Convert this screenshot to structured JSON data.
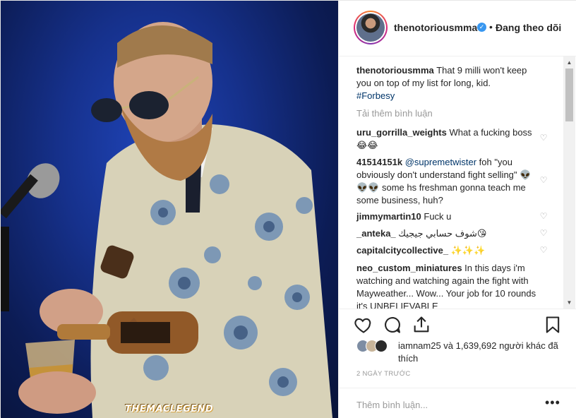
{
  "header": {
    "username": "thenotoriousmma",
    "separator": "•",
    "follow_status": "Đang theo dõi"
  },
  "caption": {
    "username": "thenotoriousmma",
    "text": "That 9 milli won't keep you on top of my list for long, kid.",
    "hashtag": "#Forbesy"
  },
  "load_more": "Tải thêm bình luận",
  "comments": [
    {
      "username": "uru_gorrilla_weights",
      "text": "What a fucking boss 😂😂"
    },
    {
      "username": "41514151k",
      "mention": "@supremetwister",
      "text": "foh \"you obviously don't understand fight selling\" 👽👽👽 some hs freshman gonna teach me some business, huh?"
    },
    {
      "username": "jimmymartin10",
      "text": "Fuck u"
    },
    {
      "username": "_anteka_",
      "text": "شوف حسابي جيجيك😘"
    },
    {
      "username": "capitalcitycollective_",
      "text": "✨✨✨"
    },
    {
      "username": "neo_custom_miniatures",
      "text": "In this days i'm watching and watching again the fight with Mayweather... Wow... Your job for 10 rounds it's UNBELIEVABLE"
    }
  ],
  "likes": {
    "text": "iamnam25 và 1,639,692 người khác đã thích"
  },
  "timestamp": "2 NGÀY TRƯỚC",
  "add_comment_placeholder": "Thêm bình luận...",
  "more_label": "•••",
  "image": {
    "watermark": "THEMACLEGEND"
  },
  "icons": {
    "like": "heart-icon",
    "comment": "comment-icon",
    "share": "share-icon",
    "save": "bookmark-icon",
    "verified": "verified-badge-icon"
  },
  "colors": {
    "link": "#003569",
    "verified": "#3897f0",
    "muted": "#999999",
    "text": "#262626"
  }
}
